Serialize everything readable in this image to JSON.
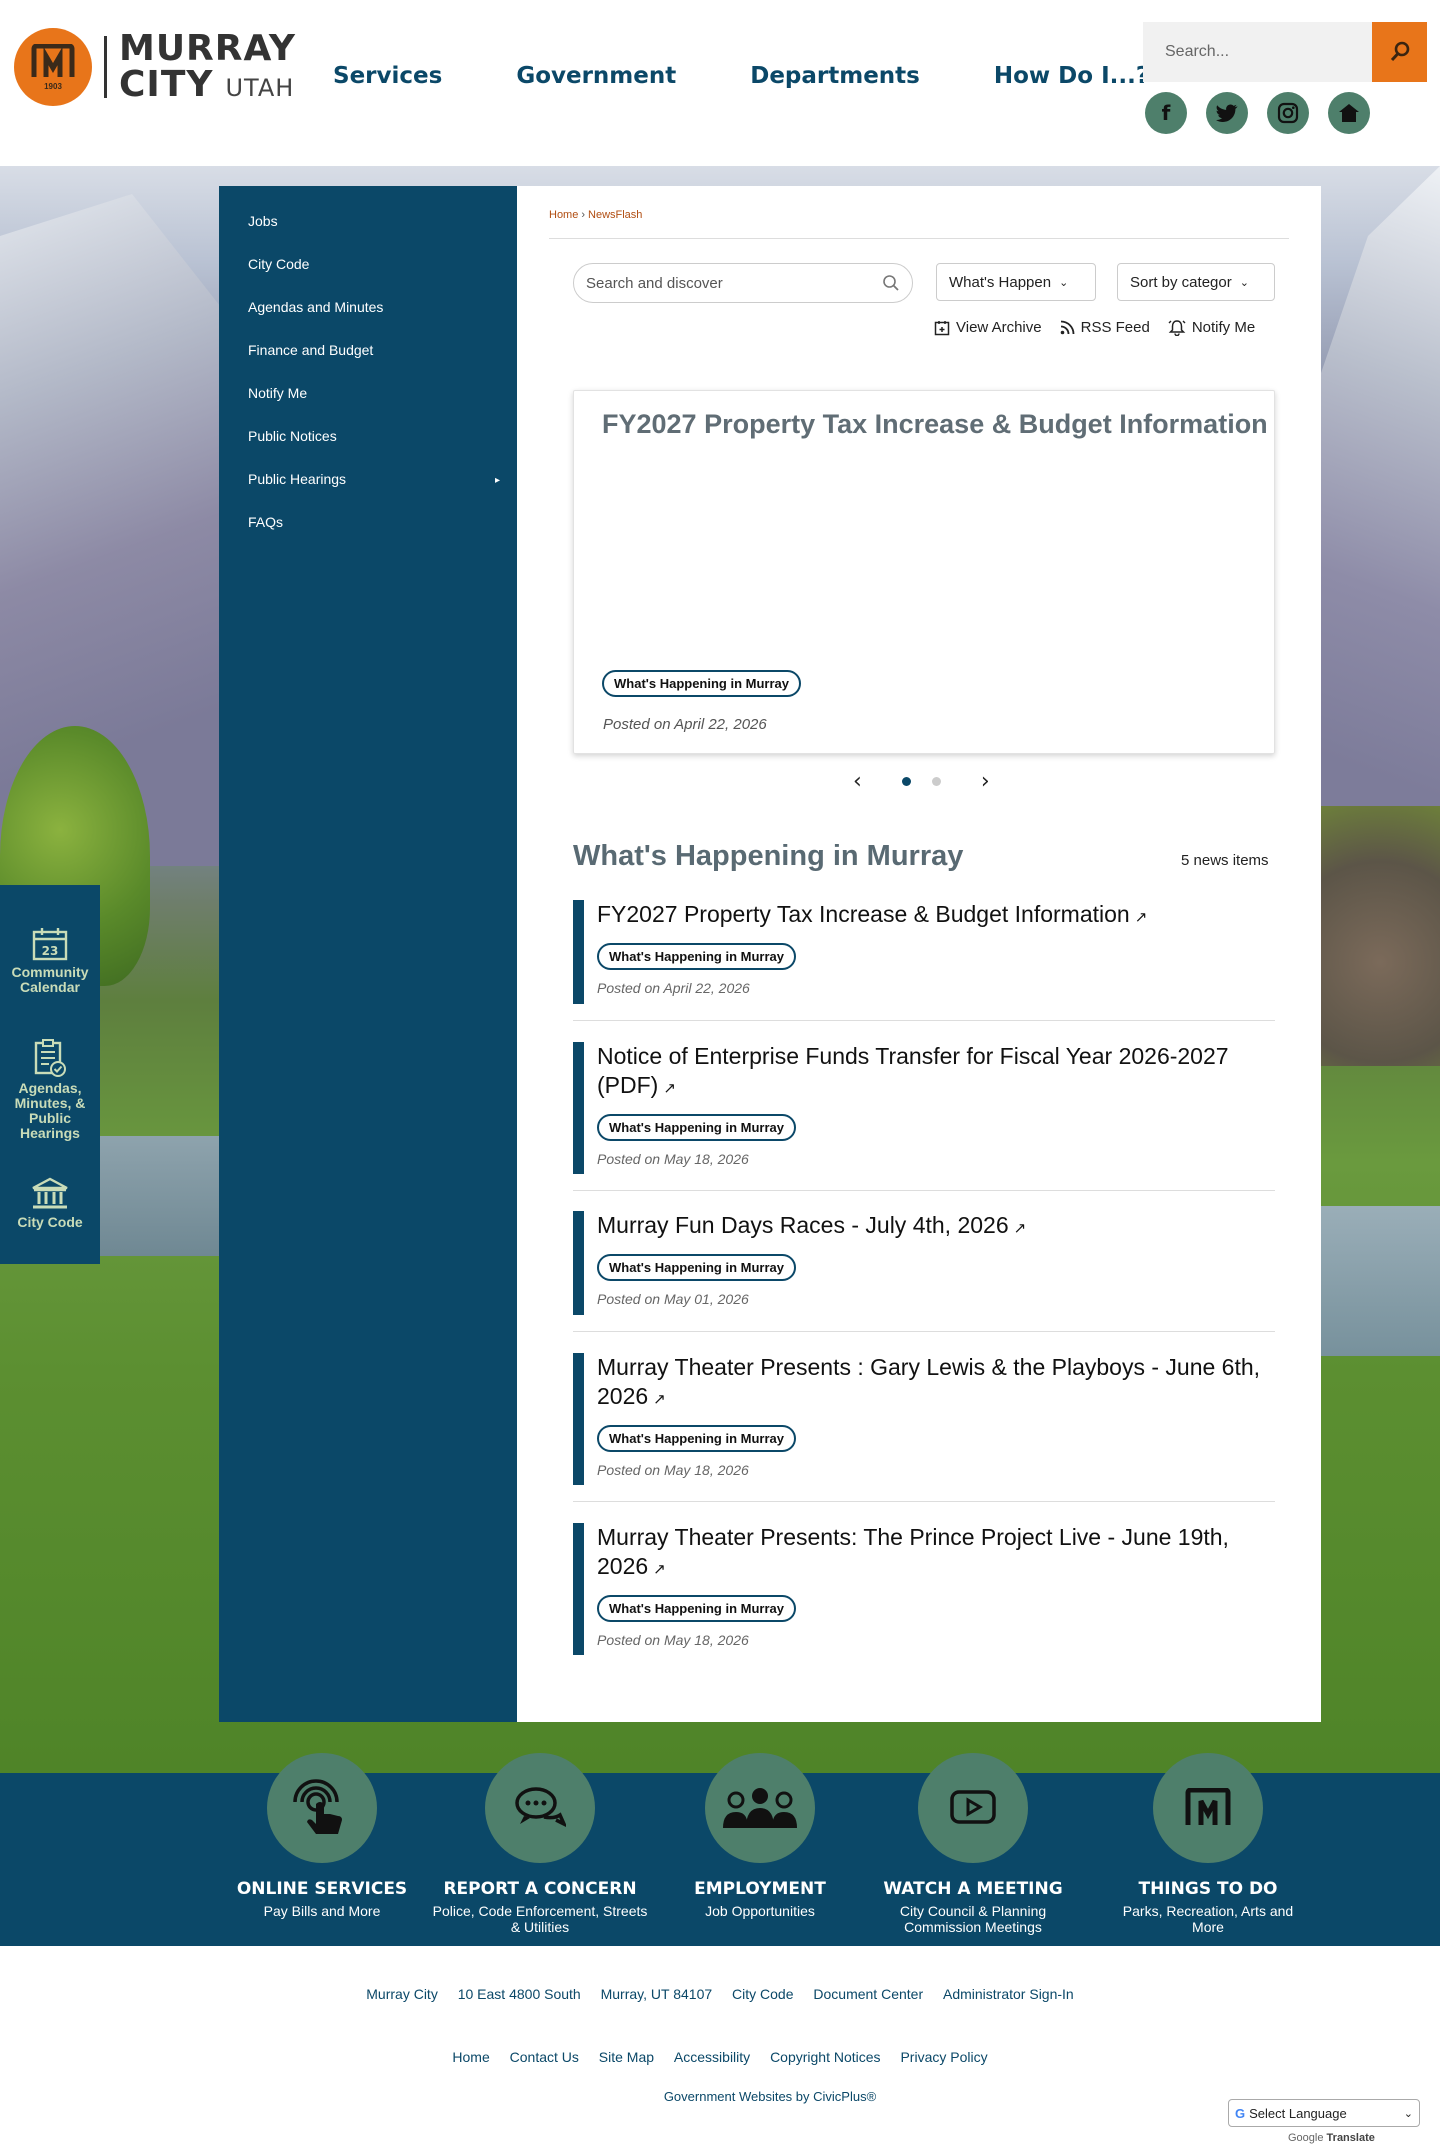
{
  "header": {
    "logo": {
      "name_line1": "MURRAY",
      "name_line2": "CITY",
      "state": "UTAH",
      "year": "1903"
    },
    "nav": [
      "Services",
      "Government",
      "Departments",
      "How Do I...?"
    ],
    "search": {
      "placeholder": "Search..."
    },
    "social": [
      "facebook-icon",
      "twitter-icon",
      "instagram-icon",
      "home-icon"
    ],
    "colors": {
      "accent": "#e8751a",
      "brand_blue": "#0b4868",
      "green": "#4e7f6b"
    }
  },
  "quick_links": [
    {
      "label": "Community Calendar",
      "icon": "calendar-icon",
      "day": "23"
    },
    {
      "label": "Agendas, Minutes, & Public Hearings",
      "icon": "clipboard-icon"
    },
    {
      "label": "City Code",
      "icon": "building-icon"
    }
  ],
  "sidenav": {
    "items": [
      {
        "label": "Jobs"
      },
      {
        "label": "City Code"
      },
      {
        "label": "Agendas and Minutes"
      },
      {
        "label": "Finance and Budget"
      },
      {
        "label": "Notify Me"
      },
      {
        "label": "Public Notices"
      },
      {
        "label": "Public Hearings",
        "arrow": "▸"
      },
      {
        "label": "FAQs"
      }
    ]
  },
  "main": {
    "breadcrumb": {
      "home": "Home",
      "sep": "›",
      "current": "NewsFlash"
    },
    "search": {
      "placeholder": "Search and discover"
    },
    "category_select": "What's Happen",
    "sort_select": "Sort by categor",
    "tools": {
      "archive": "View Archive",
      "rss": "RSS Feed",
      "notify": "Notify Me"
    },
    "featured": {
      "title": "FY2027 Property Tax Increase & Budget Information",
      "category": "What's Happening in Murray",
      "date": "Posted on April 22, 2026"
    },
    "carousel": {
      "prev": "‹",
      "next": "›",
      "slides": 2,
      "active": 1
    },
    "list": {
      "heading": "What's Happening in Murray",
      "count": "5 news items",
      "items": [
        {
          "title": "FY2027 Property Tax Increase & Budget Information",
          "category": "What's Happening in Murray",
          "date": "Posted on April 22, 2026"
        },
        {
          "title": "Notice of Enterprise Funds Transfer for Fiscal Year 2026-2027 (PDF)",
          "category": "What's Happening in Murray",
          "date": "Posted on May 18, 2026"
        },
        {
          "title": "Murray Fun Days Races - July 4th, 2026",
          "category": "What's Happening in Murray",
          "date": "Posted on May 01, 2026"
        },
        {
          "title": "Murray Theater Presents : Gary Lewis & the Playboys - June 6th, 2026",
          "category": "What's Happening in Murray",
          "date": "Posted on May 18, 2026"
        },
        {
          "title": "Murray Theater Presents: The Prince Project Live - June 19th, 2026",
          "category": "What's Happening in Murray",
          "date": "Posted on May 18, 2026"
        }
      ]
    }
  },
  "services": [
    {
      "title": "ONLINE SERVICES",
      "sub": "Pay Bills and More",
      "icon": "touch-icon"
    },
    {
      "title": "REPORT A CONCERN",
      "sub": "Police, Code Enforcement, Streets & Utilities",
      "icon": "chat-icon"
    },
    {
      "title": "EMPLOYMENT",
      "sub": "Job Opportunities",
      "icon": "people-icon"
    },
    {
      "title": "WATCH A MEETING",
      "sub": "City Council & Planning Commission Meetings",
      "icon": "play-icon"
    },
    {
      "title": "THINGS TO DO",
      "sub": "Parks, Recreation, Arts and More",
      "icon": "murray-m-icon"
    }
  ],
  "footer": {
    "row1": [
      "Murray City",
      "10 East 4800 South",
      "Murray, UT 84107",
      "City Code",
      "Document Center",
      "Administrator Sign-In"
    ],
    "row2": [
      "Home",
      "Contact Us",
      "Site Map",
      "Accessibility",
      "Copyright Notices",
      "Privacy Policy"
    ],
    "credit": "Government Websites by CivicPlus®",
    "language": {
      "label": "Select Language",
      "powered": "Google",
      "translate": "Translate"
    }
  }
}
